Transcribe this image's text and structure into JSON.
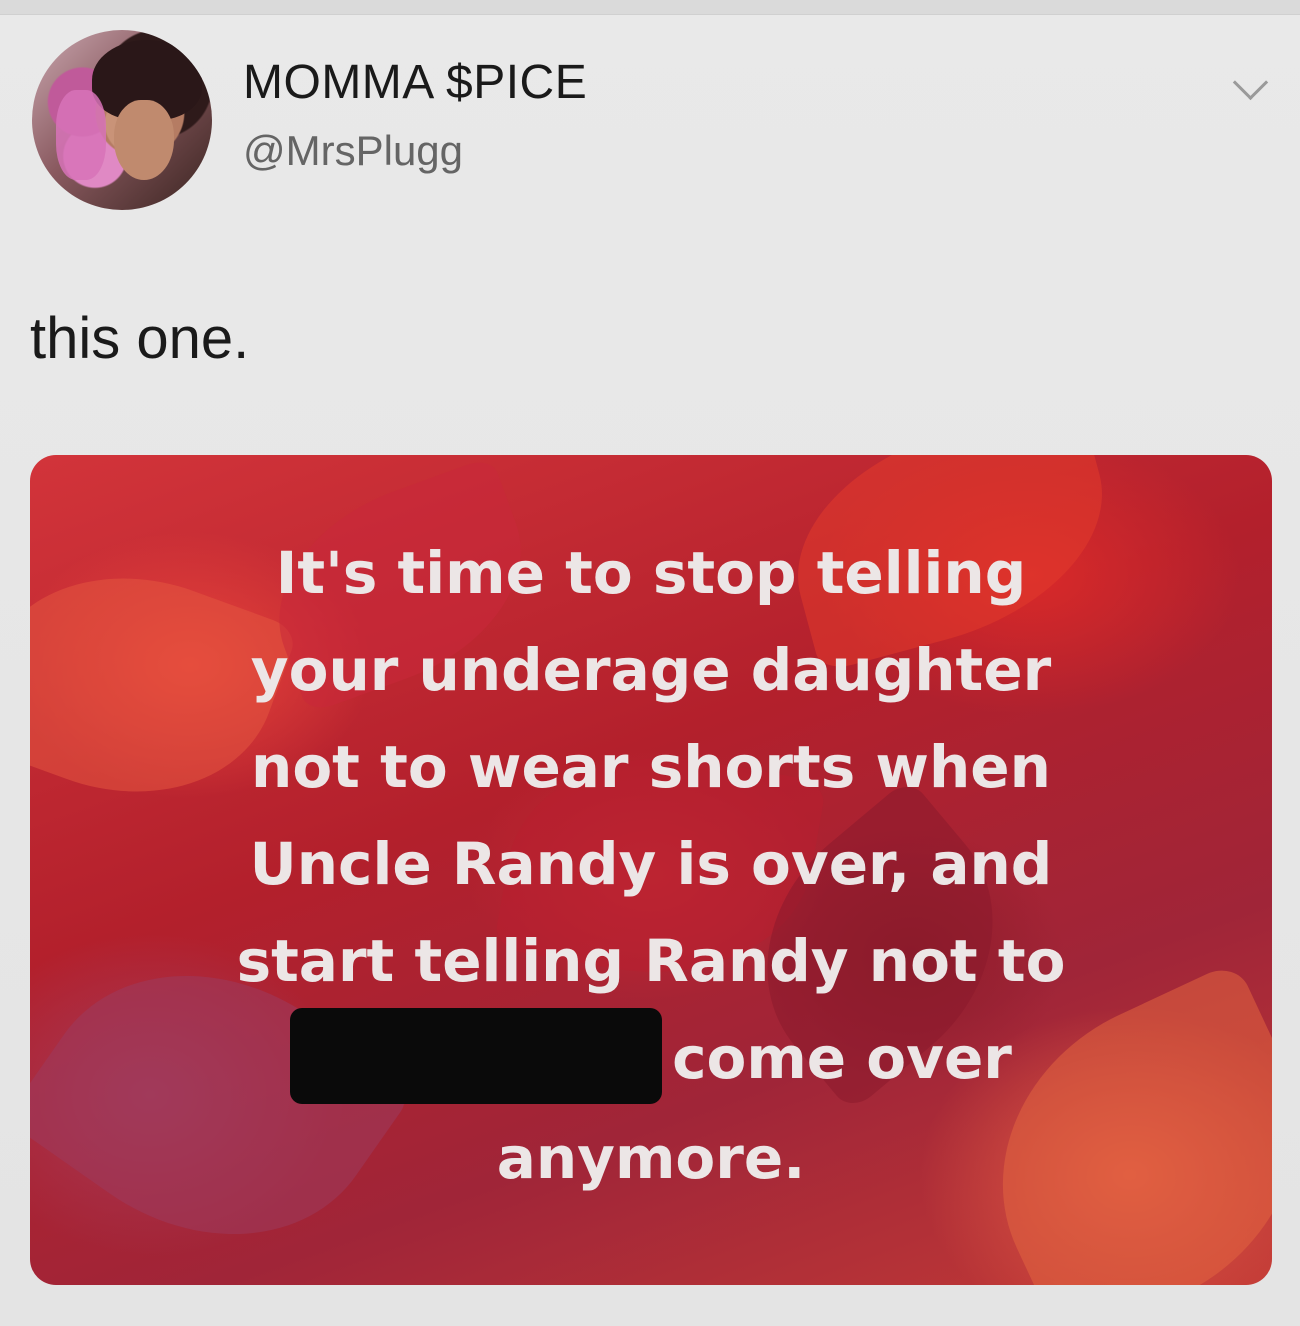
{
  "tweet": {
    "display_name": "MOMMA $PICE",
    "handle": "@MrsPlugg",
    "text": "this one."
  },
  "media": {
    "lines": [
      "It's time to stop telling",
      "your underage daughter",
      "not to wear shorts when",
      "Uncle Randy is over, and",
      "start telling Randy not to"
    ],
    "line_after_redaction": "come over",
    "last_line": "anymore."
  },
  "colors": {
    "background": "#e6e6e6",
    "media_red": "#c22a34",
    "media_text": "#ece6e6",
    "redaction": "#0a0a0a"
  },
  "icons": {
    "menu": "chevron-down-icon"
  }
}
